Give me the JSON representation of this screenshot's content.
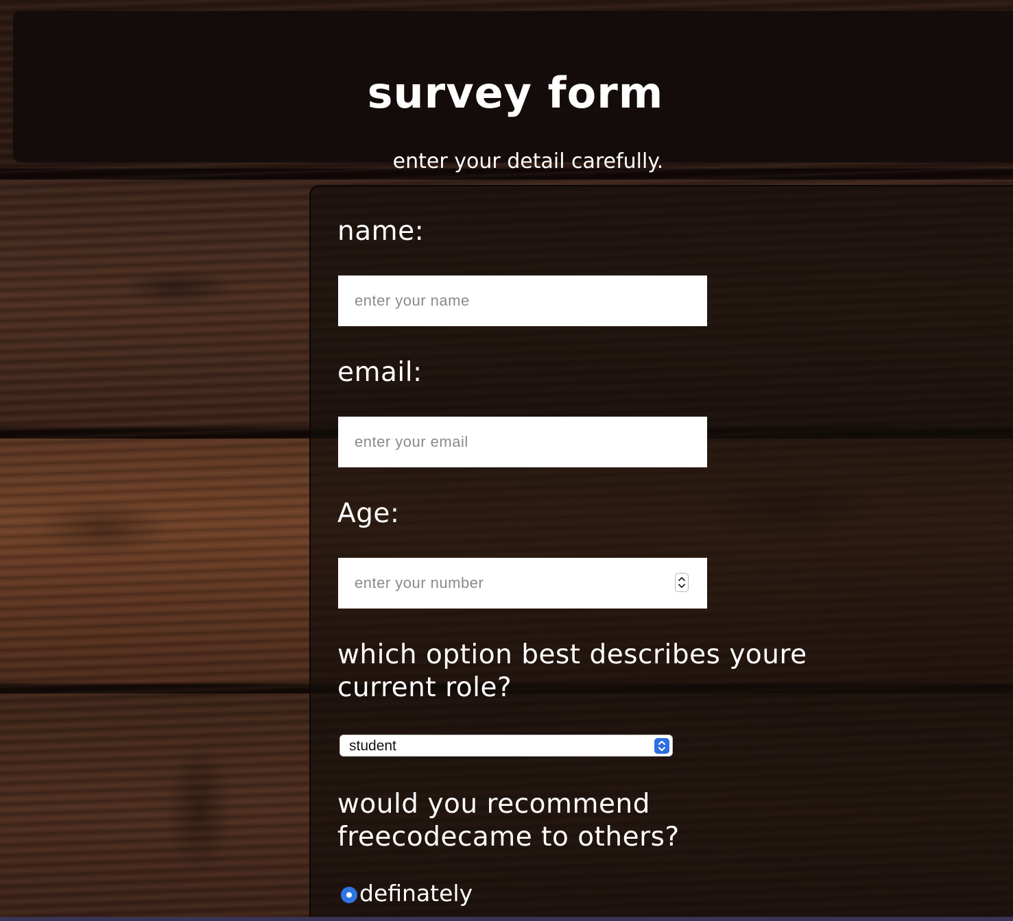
{
  "header": {
    "title": "survey form",
    "subtitle": "enter your detail carefully."
  },
  "form": {
    "name": {
      "label": "name:",
      "placeholder": "enter your name",
      "value": ""
    },
    "email": {
      "label": "email:",
      "placeholder": "enter your email",
      "value": ""
    },
    "age": {
      "label": "Age:",
      "placeholder": "enter your number",
      "value": ""
    },
    "role": {
      "question_line1": "which option best describes youre",
      "question_line2": "current role?",
      "selected": "student"
    },
    "recommend": {
      "question_line1": "would you recommend",
      "question_line2": "freecodecame to others?",
      "options": [
        {
          "label": "definately",
          "checked": true
        }
      ]
    }
  },
  "colors": {
    "accent": "#2f74e3",
    "panel": "#120c0a",
    "text": "#ffffff"
  },
  "icons": {
    "stepper": "up-down-chevron-icon",
    "select_arrows": "select-chevrons-icon"
  }
}
